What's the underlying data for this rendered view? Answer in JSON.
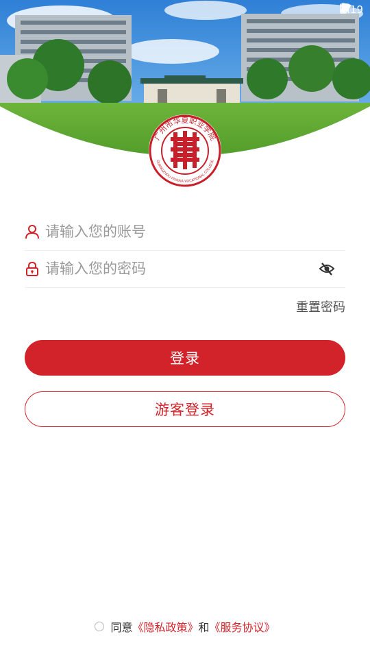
{
  "status_bar": {
    "time": "4:19"
  },
  "icons": {
    "user": "user-outline-icon",
    "lock": "lock-icon",
    "eye": "eye-slash-icon",
    "logo": "school-seal-logo"
  },
  "colors": {
    "accent": "#d2232a",
    "placeholder": "#9a9a9a",
    "divider": "#ececec"
  },
  "login": {
    "account_placeholder": "请输入您的账号",
    "password_placeholder": "请输入您的密码",
    "reset_password": "重置密码",
    "login_button": "登录",
    "guest_button": "游客登录"
  },
  "agreement": {
    "agree": "同意",
    "privacy_link": "《隐私政策》",
    "and": "和",
    "service_link": "《服务协议》"
  },
  "logo": {
    "school_name_cn": "广州市华夏职业学院",
    "school_name_en": "GUANGZHOU HUAXIA VOCATIONAL COLLEGE"
  }
}
